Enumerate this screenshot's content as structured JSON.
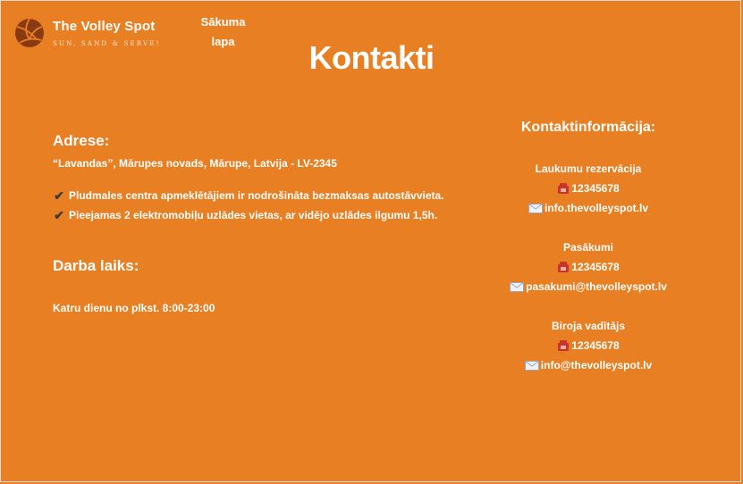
{
  "brand": {
    "name": "The Volley Spot",
    "tagline": "SUN, SAND & SERVE!"
  },
  "nav": {
    "home_label_line1": "Sākuma",
    "home_label_line2": "lapa"
  },
  "page": {
    "title": "Kontakti"
  },
  "address": {
    "heading": "Adrese:",
    "text": "“Lavandas”, Mārupes novads, Mārupe, Latvija - LV-2345",
    "features": [
      "Pludmales centra apmeklētājiem ir nodrošināta bezmaksas  autostāvvieta.",
      "Pieejamas 2 elektromobiļu uzlādes vietas, ar vidējo uzlādes ilgumu 1,5h."
    ]
  },
  "hours": {
    "heading": "Darba laiks:",
    "text": "Katru dienu no plkst. 8:00-23:00"
  },
  "contacts": {
    "heading": "Kontaktinformācija:",
    "groups": [
      {
        "title": "Laukumu rezervācija",
        "phone": "12345678",
        "email": "info.thevolleyspot.lv"
      },
      {
        "title": "Pasākumi",
        "phone": "12345678",
        "email": "pasakumi@thevolleyspot.lv"
      },
      {
        "title": "Biroja vadītājs",
        "phone": "12345678",
        "email": "info@thevolleyspot.lv"
      }
    ]
  },
  "colors": {
    "background": "#e87f22",
    "text": "#ffffff",
    "logo_ball": "#8a3a12",
    "phone_icon": "#c8332b",
    "check_icon": "#3a3a3a"
  },
  "icons": {
    "logo": "volleyball-icon",
    "phone": "telephone-icon",
    "email": "envelope-icon",
    "feature": "checkmark-icon"
  }
}
